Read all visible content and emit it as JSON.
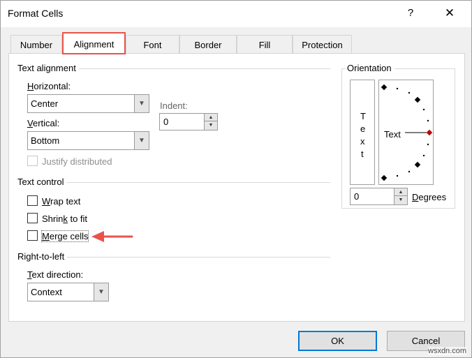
{
  "window": {
    "title": "Format Cells",
    "help": "?",
    "close": "✕"
  },
  "tabs": [
    {
      "label": "Number"
    },
    {
      "label": "Alignment"
    },
    {
      "label": "Font"
    },
    {
      "label": "Border"
    },
    {
      "label": "Fill"
    },
    {
      "label": "Protection"
    }
  ],
  "text_alignment": {
    "group": "Text alignment",
    "horizontal_label_u": "H",
    "horizontal_label_rest": "orizontal:",
    "horizontal_value": "Center",
    "vertical_label_u": "V",
    "vertical_label_rest": "ertical:",
    "vertical_value": "Bottom",
    "indent_label": "Indent:",
    "indent_value": "0",
    "justify_label": "Justify distributed"
  },
  "text_control": {
    "group": "Text control",
    "wrap_u": "W",
    "wrap_rest": "rap text",
    "shrink_pre": "Shrin",
    "shrink_u": "k",
    "shrink_rest": " to fit",
    "merge_u": "M",
    "merge_rest": "erge cells"
  },
  "rtl": {
    "group": "Right-to-left",
    "direction_u": "T",
    "direction_rest": "ext direction:",
    "direction_value": "Context"
  },
  "orientation": {
    "group": "Orientation",
    "vertical_text": [
      "T",
      "e",
      "x",
      "t"
    ],
    "dial_text": "Text",
    "degrees_value": "0",
    "degrees_u": "D",
    "degrees_rest": "egrees"
  },
  "buttons": {
    "ok": "OK",
    "cancel": "Cancel"
  },
  "watermark": "wsxdn.com",
  "colors": {
    "highlight": "#e8544a",
    "default_button": "#0078d7"
  }
}
